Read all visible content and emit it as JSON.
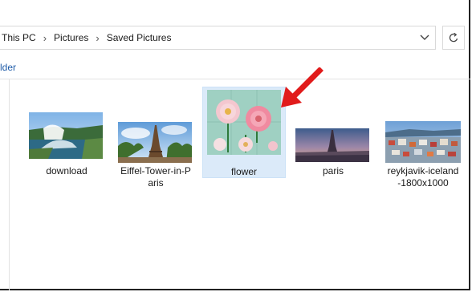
{
  "address_bar": {
    "breadcrumbs": [
      "This PC",
      "Pictures",
      "Saved Pictures"
    ]
  },
  "toolbar": {
    "fragment_label": "lder"
  },
  "icons": {
    "breadcrumb_separator": "chevron-right-icon",
    "history_dropdown": "chevron-down-icon",
    "refresh": "refresh-icon",
    "annotation": "red-arrow-annotation"
  },
  "files": [
    {
      "name": "download",
      "selected": false
    },
    {
      "name": "Eiffel-Tower-in-Paris",
      "name_lines": [
        "Eiffel-Tower-in-P",
        "aris"
      ],
      "selected": false
    },
    {
      "name": "flower",
      "selected": true
    },
    {
      "name": "paris",
      "selected": false
    },
    {
      "name": "reykjavik-iceland-1800x1000",
      "name_lines": [
        "reykjavik-iceland",
        "-1800x1000"
      ],
      "selected": false
    }
  ],
  "colors": {
    "selection_bg": "#dbeaf9",
    "accent_link": "#1e5ba8",
    "annotation_arrow": "#e11b1b"
  }
}
